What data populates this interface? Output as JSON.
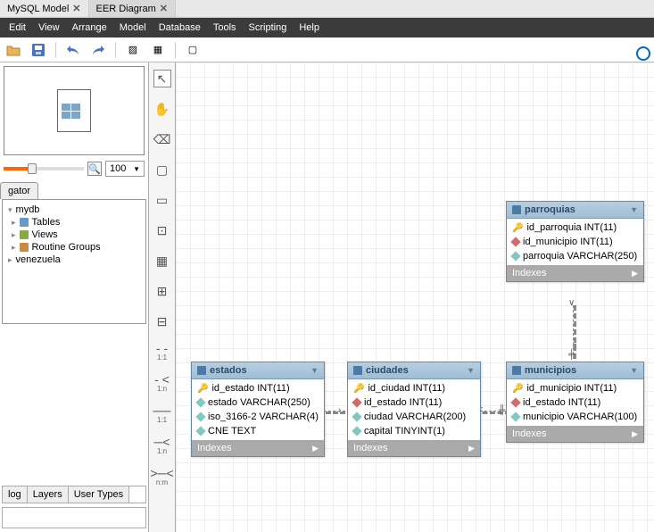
{
  "tabs": [
    {
      "label": "MySQL Model"
    },
    {
      "label": "EER Diagram"
    }
  ],
  "menu": [
    "Edit",
    "View",
    "Arrange",
    "Model",
    "Database",
    "Tools",
    "Scripting",
    "Help"
  ],
  "zoom": {
    "value": "100"
  },
  "navigator_tab": "gator",
  "tree": {
    "db": "mydb",
    "items": [
      "Tables",
      "Views",
      "Routine Groups"
    ],
    "db2": "venezuela"
  },
  "bottom_tabs": [
    "log",
    "Layers",
    "User Types"
  ],
  "rel_labels": [
    "1:1",
    "1:n",
    "1:1",
    "1:n",
    "n:m"
  ],
  "entities": {
    "estados": {
      "name": "estados",
      "cols": [
        {
          "k": "key",
          "text": "id_estado INT(11)"
        },
        {
          "k": "d",
          "text": "estado VARCHAR(250)"
        },
        {
          "k": "d",
          "text": "iso_3166-2 VARCHAR(4)"
        },
        {
          "k": "d",
          "text": "CNE TEXT"
        }
      ],
      "footer": "Indexes"
    },
    "ciudades": {
      "name": "ciudades",
      "cols": [
        {
          "k": "key",
          "text": "id_ciudad INT(11)"
        },
        {
          "k": "r",
          "text": "id_estado INT(11)"
        },
        {
          "k": "d",
          "text": "ciudad VARCHAR(200)"
        },
        {
          "k": "d",
          "text": "capital TINYINT(1)"
        }
      ],
      "footer": "Indexes"
    },
    "municipios": {
      "name": "municipios",
      "cols": [
        {
          "k": "key",
          "text": "id_municipio INT(11)"
        },
        {
          "k": "r",
          "text": "id_estado INT(11)"
        },
        {
          "k": "d",
          "text": "municipio VARCHAR(100)"
        }
      ],
      "footer": "Indexes"
    },
    "parroquias": {
      "name": "parroquias",
      "cols": [
        {
          "k": "key",
          "text": "id_parroquia INT(11)"
        },
        {
          "k": "r",
          "text": "id_municipio INT(11)"
        },
        {
          "k": "d",
          "text": "parroquia VARCHAR(250)"
        }
      ],
      "footer": "Indexes"
    }
  }
}
